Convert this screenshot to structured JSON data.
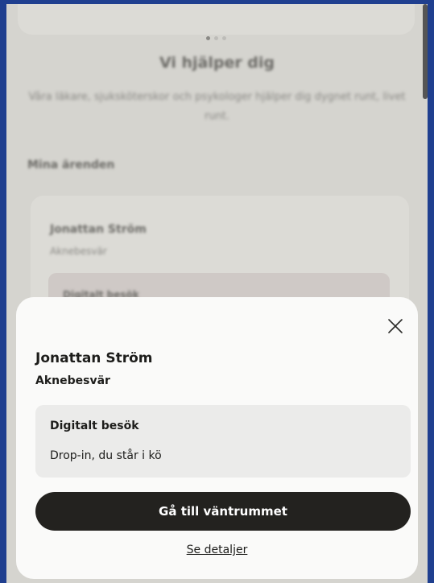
{
  "background": {
    "hero": {
      "title": "Vi hjälper dig",
      "subtitle": "Våra läkare, sjuksköterskor och psykologer hjälper dig dygnet runt, livet runt."
    },
    "section_title": "Mina ärenden",
    "case_card": {
      "name": "Jonattan Ström",
      "topic": "Aknebesvär",
      "visit_type": "Digitalt besök"
    },
    "carousel": {
      "pages": 3,
      "active": 1
    }
  },
  "sheet": {
    "case_name": "Jonattan Ström",
    "case_topic": "Aknebesvär",
    "visit": {
      "type": "Digitalt besök",
      "status": "Drop-in, du står i kö"
    },
    "primary_button": "Gå till väntrummet",
    "details_link": "Se detaljer",
    "close_icon": "close-icon"
  },
  "colors": {
    "primary_button_bg": "#23221f",
    "overlay_bg": "#d5d4cf",
    "sheet_bg": "#fafaf9",
    "frame_border": "#1f3f8f"
  }
}
